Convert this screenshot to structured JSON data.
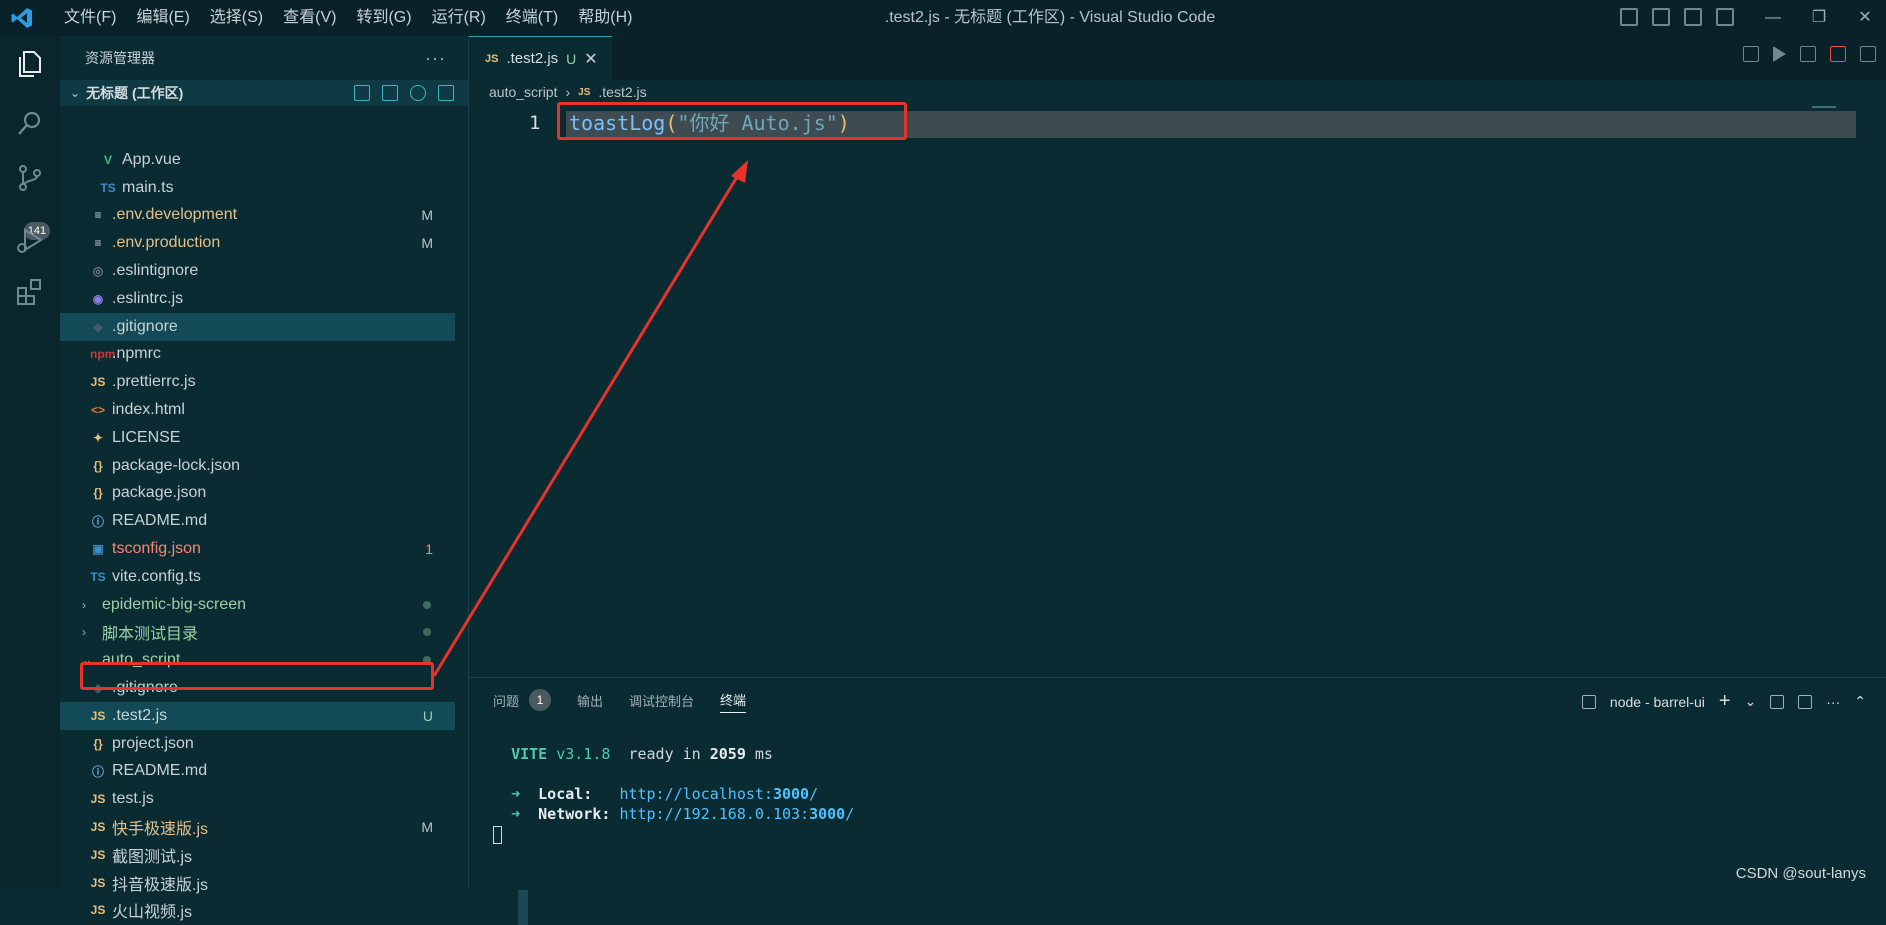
{
  "menubar": {
    "items": [
      "文件(F)",
      "编辑(E)",
      "选择(S)",
      "查看(V)",
      "转到(G)",
      "运行(R)",
      "终端(T)",
      "帮助(H)"
    ]
  },
  "window_title": ".test2.js - 无标题 (工作区) - Visual Studio Code",
  "activity": {
    "scm_badge": "141"
  },
  "explorer": {
    "title": "资源管理器",
    "more": "···",
    "workspace": "无标题 (工作区)",
    "files": [
      {
        "icon": "vue-icon",
        "glyph": "V",
        "color": "#41b883",
        "name": "App.vue",
        "status": "",
        "style": "",
        "indent": 1
      },
      {
        "icon": "ts-icon",
        "glyph": "TS",
        "color": "#3b8ec9",
        "name": "main.ts",
        "status": "",
        "style": "",
        "indent": 1
      },
      {
        "icon": "lines-icon",
        "glyph": "≡",
        "color": "#c8d2d6",
        "name": ".env.development",
        "status": "M",
        "style": "mod",
        "indent": 0
      },
      {
        "icon": "lines-icon",
        "glyph": "≡",
        "color": "#c8d2d6",
        "name": ".env.production",
        "status": "M",
        "style": "mod",
        "indent": 0
      },
      {
        "icon": "circle-icon",
        "glyph": "◎",
        "color": "#6d7c80",
        "name": ".eslintignore",
        "status": "",
        "style": "",
        "indent": 0
      },
      {
        "icon": "eslint-icon",
        "glyph": "◉",
        "color": "#8b7fe0",
        "name": ".eslintrc.js",
        "status": "",
        "style": "",
        "indent": 0
      },
      {
        "icon": "git-icon",
        "glyph": "◆",
        "color": "#4a5a60",
        "name": ".gitignore",
        "status": "",
        "style": "",
        "indent": 0
      },
      {
        "icon": "npm-icon",
        "glyph": "npm",
        "color": "#cb3837",
        "name": ".npmrc",
        "status": "",
        "style": "",
        "indent": 0
      },
      {
        "icon": "js-icon",
        "glyph": "JS",
        "color": "#e5c07b",
        "name": ".prettierrc.js",
        "status": "",
        "style": "",
        "indent": 0
      },
      {
        "icon": "html-icon",
        "glyph": "<>",
        "color": "#e37933",
        "name": "index.html",
        "status": "",
        "style": "",
        "indent": 0
      },
      {
        "icon": "license-icon",
        "glyph": "✦",
        "color": "#e5c07b",
        "name": "LICENSE",
        "status": "",
        "style": "",
        "indent": 0
      },
      {
        "icon": "json-icon",
        "glyph": "{}",
        "color": "#e5c07b",
        "name": "package-lock.json",
        "status": "",
        "style": "",
        "indent": 0
      },
      {
        "icon": "json-icon",
        "glyph": "{}",
        "color": "#e5c07b",
        "name": "package.json",
        "status": "",
        "style": "",
        "indent": 0
      },
      {
        "icon": "info-icon",
        "glyph": "ⓘ",
        "color": "#6fa8dc",
        "name": "README.md",
        "status": "",
        "style": "",
        "indent": 0
      },
      {
        "icon": "tsconfig-icon",
        "glyph": "▣",
        "color": "#3b8ec9",
        "name": "tsconfig.json",
        "status": "1",
        "style": "err",
        "indent": 0
      },
      {
        "icon": "ts-icon",
        "glyph": "TS",
        "color": "#3b8ec9",
        "name": "vite.config.ts",
        "status": "",
        "style": "",
        "indent": 0
      }
    ],
    "folders": [
      {
        "name": "epidemic-big-screen",
        "expanded": false
      },
      {
        "name": "脚本测试目录",
        "expanded": false
      },
      {
        "name": "auto_script",
        "expanded": true
      }
    ],
    "auto_script_files": [
      {
        "icon": "git-icon",
        "glyph": "◆",
        "color": "#4a5a60",
        "name": ".gitignore",
        "status": "",
        "style": ""
      },
      {
        "icon": "js-icon",
        "glyph": "JS",
        "color": "#e5c07b",
        "name": ".test2.js",
        "status": "U",
        "style": "active"
      },
      {
        "icon": "json-icon",
        "glyph": "{}",
        "color": "#e5c07b",
        "name": "project.json",
        "status": "",
        "style": ""
      },
      {
        "icon": "info-icon",
        "glyph": "ⓘ",
        "color": "#6fa8dc",
        "name": "README.md",
        "status": "",
        "style": ""
      },
      {
        "icon": "js-icon",
        "glyph": "JS",
        "color": "#e5c07b",
        "name": "test.js",
        "status": "",
        "style": ""
      },
      {
        "icon": "js-icon",
        "glyph": "JS",
        "color": "#e5c07b",
        "name": "快手极速版.js",
        "status": "M",
        "style": "mod"
      },
      {
        "icon": "js-icon",
        "glyph": "JS",
        "color": "#e5c07b",
        "name": "截图测试.js",
        "status": "",
        "style": ""
      },
      {
        "icon": "js-icon",
        "glyph": "JS",
        "color": "#e5c07b",
        "name": "抖音极速版.js",
        "status": "",
        "style": ""
      },
      {
        "icon": "js-icon",
        "glyph": "JS",
        "color": "#e5c07b",
        "name": "火山视频.js",
        "status": "",
        "style": ""
      }
    ]
  },
  "editor": {
    "tab": {
      "icon": "JS",
      "name": ".test2.js",
      "status": "U",
      "close": "✕"
    },
    "breadcrumb": {
      "folder": "auto_script",
      "sep": "›",
      "icon": "JS",
      "file": ".test2.js"
    },
    "line_number": "1",
    "code": {
      "fn": "toastLog",
      "open": "(",
      "str": "\"你好 Auto.js\"",
      "close": ")"
    }
  },
  "panel": {
    "tabs": [
      "问题",
      "输出",
      "调试控制台",
      "终端"
    ],
    "problems_count": "1",
    "active_tab": "终端",
    "terminal_name": "node - barrel-ui",
    "actions": {
      "add": "+",
      "dropdown": "⌄",
      "more": "···",
      "collapse": "⌃"
    },
    "terminal": {
      "vite": "VITE",
      "version": "v3.1.8",
      "ready": "ready in",
      "ms_value": "2059",
      "ms_unit": "ms",
      "arrow": "➜",
      "local_label": "Local:",
      "local_prefix": "http://localhost:",
      "local_port": "3000",
      "local_suffix": "/",
      "network_label": "Network:",
      "network_prefix": "http://192.168.0.103:",
      "network_port": "3000",
      "network_suffix": "/"
    }
  },
  "watermark": "CSDN @sout-lanys",
  "colors": {
    "accent": "#2aa0ad",
    "annotation": "#e8332a",
    "background": "#0b2b33"
  }
}
